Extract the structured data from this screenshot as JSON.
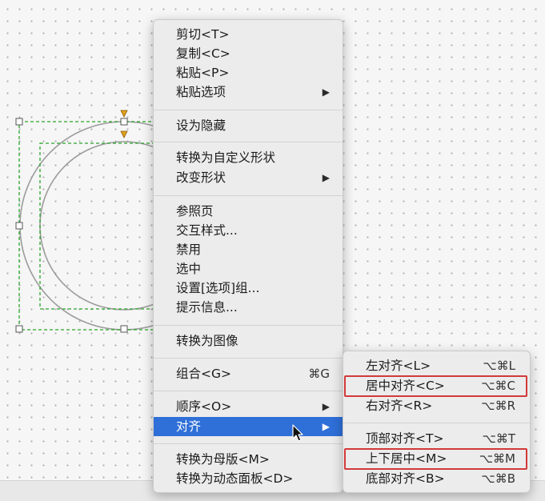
{
  "main_menu": {
    "items": [
      {
        "label": "剪切<T>"
      },
      {
        "label": "复制<C>"
      },
      {
        "label": "粘贴<P>"
      },
      {
        "label": "粘贴选项",
        "arrow": "▶"
      },
      {
        "label": "设为隐藏"
      },
      {
        "label": "转换为自定义形状"
      },
      {
        "label": "改变形状",
        "arrow": "▶"
      },
      {
        "label": "参照页"
      },
      {
        "label": "交互样式..."
      },
      {
        "label": "禁用"
      },
      {
        "label": "选中"
      },
      {
        "label": "设置[选项]组..."
      },
      {
        "label": "提示信息..."
      },
      {
        "label": "转换为图像"
      },
      {
        "label": "组合<G>",
        "shortcut": "⌘G"
      },
      {
        "label": "顺序<O>",
        "arrow": "▶"
      },
      {
        "label": "对齐",
        "arrow": "▶",
        "state": "highlighted"
      },
      {
        "label": "转换为母版<M>"
      },
      {
        "label": "转换为动态面板<D>"
      }
    ]
  },
  "align_submenu": {
    "items": [
      {
        "label": "左对齐<L>",
        "shortcut": "⌥⌘L"
      },
      {
        "label": "居中对齐<C>",
        "shortcut": "⌥⌘C",
        "annotated": true
      },
      {
        "label": "右对齐<R>",
        "shortcut": "⌥⌘R"
      },
      {
        "label": "顶部对齐<T>",
        "shortcut": "⌥⌘T"
      },
      {
        "label": "上下居中<M>",
        "shortcut": "⌥⌘M",
        "annotated": true
      },
      {
        "label": "底部对齐<B>",
        "shortcut": "⌥⌘B"
      }
    ]
  },
  "colors": {
    "highlight": "#2f6fd8",
    "annotation": "#d23a3a",
    "selection": "#2aa52a",
    "handle_marker": "#e0a020"
  },
  "icons": {
    "submenu_arrow": "submenu-arrow-icon",
    "cursor": "mouse-pointer-icon"
  }
}
